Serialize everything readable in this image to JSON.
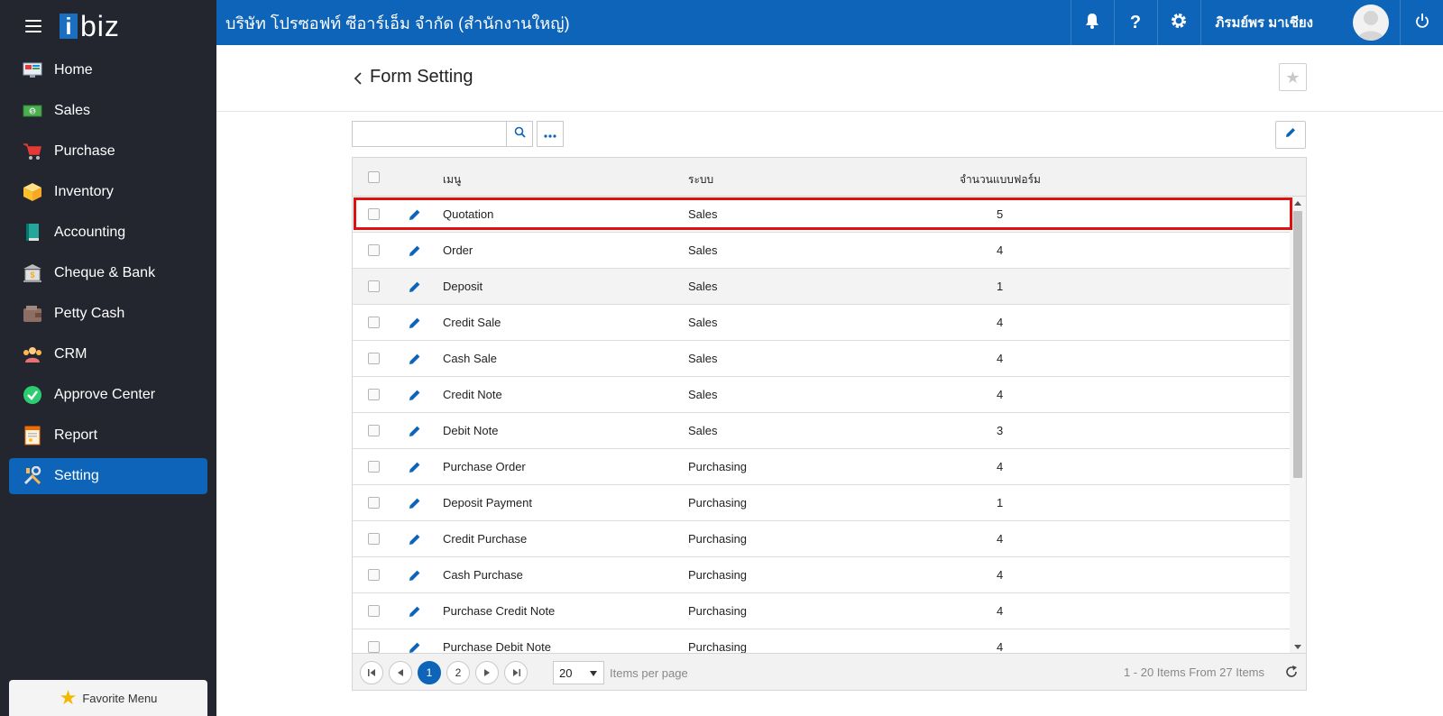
{
  "app": {
    "logo_i": "i",
    "logo_rest": "biz"
  },
  "topbar": {
    "company": "บริษัท โปรซอฟท์ ซีอาร์เอ็ม จำกัด (สำนักงานใหญ่)",
    "user_name": "ภิรมย์พร มาเชียง"
  },
  "sidebar": {
    "items": [
      {
        "label": "Home",
        "icon": "home-icon"
      },
      {
        "label": "Sales",
        "icon": "money-icon"
      },
      {
        "label": "Purchase",
        "icon": "cart-icon"
      },
      {
        "label": "Inventory",
        "icon": "box-icon"
      },
      {
        "label": "Accounting",
        "icon": "book-icon"
      },
      {
        "label": "Cheque & Bank",
        "icon": "bank-icon"
      },
      {
        "label": "Petty Cash",
        "icon": "wallet-icon"
      },
      {
        "label": "CRM",
        "icon": "people-icon"
      },
      {
        "label": "Approve Center",
        "icon": "check-circle-icon"
      },
      {
        "label": "Report",
        "icon": "report-icon"
      },
      {
        "label": "Setting",
        "icon": "tools-icon",
        "active": true
      }
    ],
    "favorite_label": "Favorite Menu"
  },
  "page": {
    "title": "Form Setting"
  },
  "search": {
    "placeholder": "",
    "value": ""
  },
  "grid": {
    "columns": {
      "menu": "เมนู",
      "system": "ระบบ",
      "count": "จำนวนแบบฟอร์ม"
    },
    "rows": [
      {
        "menu": "Quotation",
        "system": "Sales",
        "count": "5"
      },
      {
        "menu": "Order",
        "system": "Sales",
        "count": "4"
      },
      {
        "menu": "Deposit",
        "system": "Sales",
        "count": "1"
      },
      {
        "menu": "Credit Sale",
        "system": "Sales",
        "count": "4"
      },
      {
        "menu": "Cash Sale",
        "system": "Sales",
        "count": "4"
      },
      {
        "menu": "Credit Note",
        "system": "Sales",
        "count": "4"
      },
      {
        "menu": "Debit Note",
        "system": "Sales",
        "count": "3"
      },
      {
        "menu": "Purchase Order",
        "system": "Purchasing",
        "count": "4"
      },
      {
        "menu": "Deposit Payment",
        "system": "Purchasing",
        "count": "1"
      },
      {
        "menu": "Credit Purchase",
        "system": "Purchasing",
        "count": "4"
      },
      {
        "menu": "Cash Purchase",
        "system": "Purchasing",
        "count": "4"
      },
      {
        "menu": "Purchase Credit Note",
        "system": "Purchasing",
        "count": "4"
      },
      {
        "menu": "Purchase Debit Note",
        "system": "Purchasing",
        "count": "4"
      }
    ]
  },
  "pager": {
    "pages": [
      "1",
      "2"
    ],
    "current_page": "1",
    "per_page": "20",
    "per_page_label": "Items per page",
    "info": "1 - 20 Items From 27 Items"
  },
  "colors": {
    "brand": "#0d64b8",
    "sidebar": "#23252f",
    "highlight": "#e01010"
  }
}
